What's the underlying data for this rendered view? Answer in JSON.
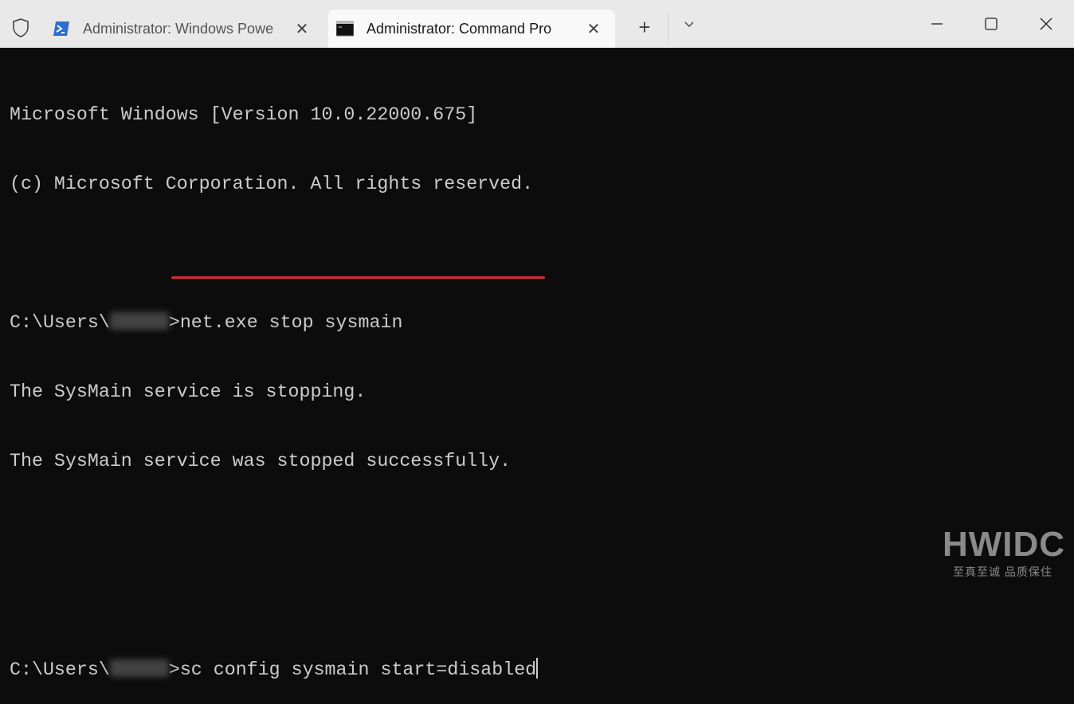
{
  "tabs": [
    {
      "title": "Administrator: Windows Powe",
      "icon": "powershell-icon",
      "active": false
    },
    {
      "title": "Administrator: Command Pro",
      "icon": "command-prompt-icon",
      "active": true
    }
  ],
  "controls": {
    "new_tab": "+",
    "dropdown": "⌄",
    "close_tab": "✕"
  },
  "terminal": {
    "lines": [
      "Microsoft Windows [Version 10.0.22000.675]",
      "(c) Microsoft Corporation. All rights reserved.",
      "",
      "",
      "The SysMain service is stopping.",
      "The SysMain service was stopped successfully.",
      "",
      "",
      ""
    ],
    "prompt_prefix": "C:\\Users\\",
    "prompt_suffix": ">",
    "command1": "net.exe stop sysmain",
    "command2": "sc config sysmain start=disabled"
  },
  "colors": {
    "background": "#0c0c0c",
    "text": "#cccccc",
    "highlight": "#e0282d",
    "titlebar": "#e9e9e9"
  },
  "watermark": {
    "logo": "HWIDC",
    "tagline": "至真至诚 品质保住"
  }
}
